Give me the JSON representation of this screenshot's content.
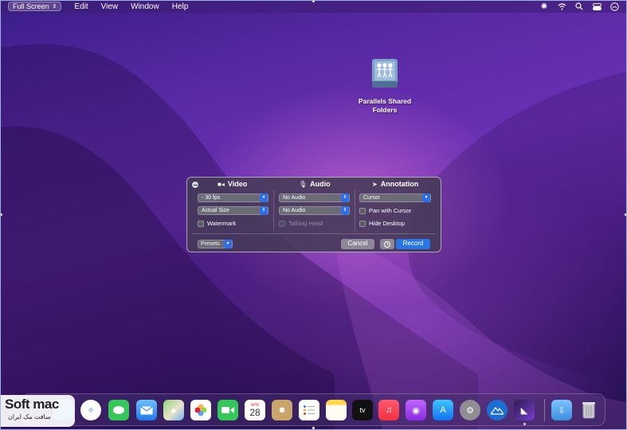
{
  "menubar": {
    "fullscreen_label": "Full Screen",
    "items": [
      "Edit",
      "View",
      "Window",
      "Help"
    ],
    "status_icons": [
      "aperture-icon",
      "wifi-icon",
      "search-icon",
      "control-center-icon",
      "smiley-icon"
    ]
  },
  "desktop": {
    "icon_label": "Parallels Shared Folders"
  },
  "recorder": {
    "video_title": "Video",
    "audio_title": "Audio",
    "annotation_title": "Annotation",
    "fps": "- 30 fps",
    "size": "Actual Size",
    "watermark": "Watermark",
    "audio1": "No Audio",
    "audio2": "No Audio",
    "talking_head": "Talking Head",
    "cursor": "Cursor",
    "pan_with_cursor": "Pan with Cursor",
    "hide_desktop": "Hide Desktop",
    "presets": "Presets",
    "cancel": "Cancel",
    "record": "Record"
  },
  "dock": {
    "calendar_month": "APR",
    "calendar_day": "28",
    "tv_label": "tv",
    "apps": [
      "finder-icon",
      "safari-icon",
      "messages-icon",
      "mail-icon",
      "maps-icon",
      "photos-icon",
      "facetime-icon",
      "calendar-icon",
      "contacts-icon",
      "reminders-icon",
      "notes-icon",
      "tv-icon",
      "music-icon",
      "podcasts-icon",
      "app-store-icon",
      "system-preferences-icon",
      "altitude-icon",
      "screen-recorder-icon",
      "downloads-folder-icon",
      "trash-icon"
    ]
  },
  "watermark": {
    "brand": "Soft mac",
    "tagline": "سافت مک ایران"
  },
  "colors": {
    "accent": "#2b76e6",
    "panel": "#463a58"
  }
}
